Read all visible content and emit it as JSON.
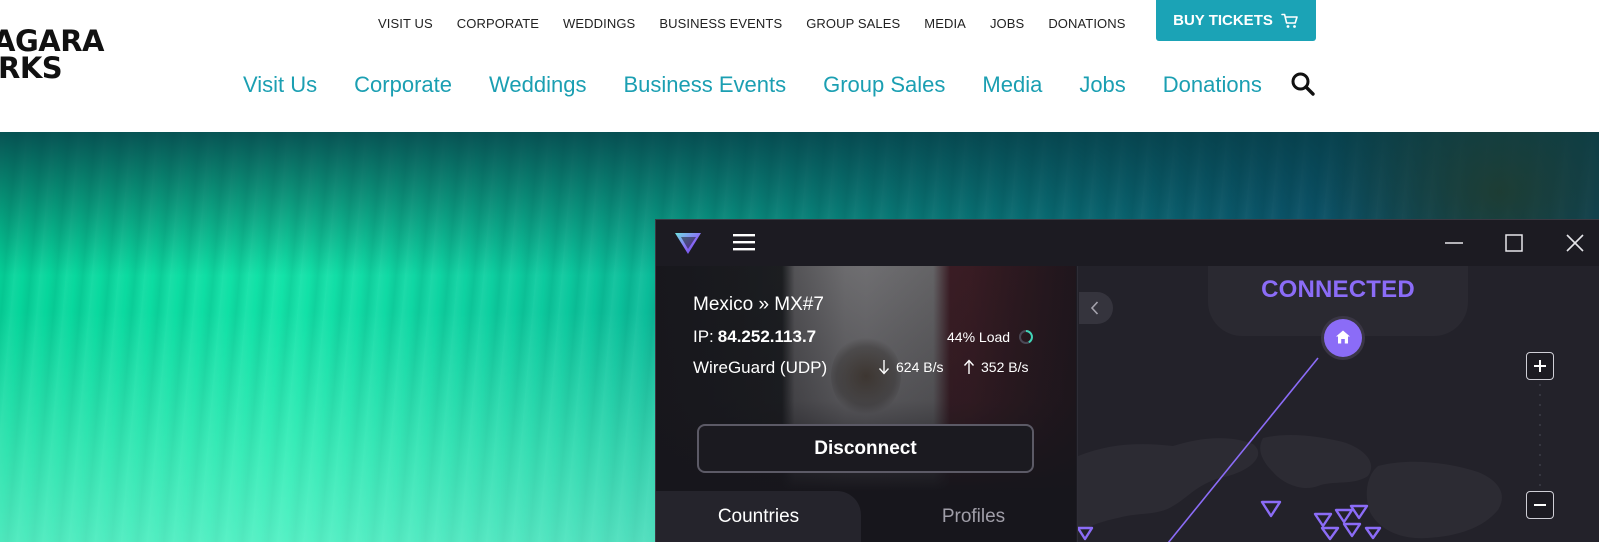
{
  "site": {
    "logo_line1": "AGARA",
    "logo_line2": "RKS",
    "top_nav": [
      "VISIT US",
      "CORPORATE",
      "WEDDINGS",
      "BUSINESS EVENTS",
      "GROUP SALES",
      "MEDIA",
      "JOBS",
      "DONATIONS"
    ],
    "buy_tickets": "BUY TICKETS",
    "main_nav": [
      "Visit Us",
      "Corporate",
      "Weddings",
      "Business Events",
      "Group Sales",
      "Media",
      "Jobs",
      "Donations"
    ],
    "accent_color": "#1ba3b6"
  },
  "vpn": {
    "server": "Mexico » MX#7",
    "ip_label": "IP:",
    "ip_value": "84.252.113.7",
    "load": "44% Load",
    "protocol": "WireGuard (UDP)",
    "download": "624 B/s",
    "upload": "352 B/s",
    "disconnect_label": "Disconnect",
    "tabs": [
      "Countries",
      "Profiles"
    ],
    "status": "CONNECTED",
    "status_color": "#8b6cf7"
  }
}
